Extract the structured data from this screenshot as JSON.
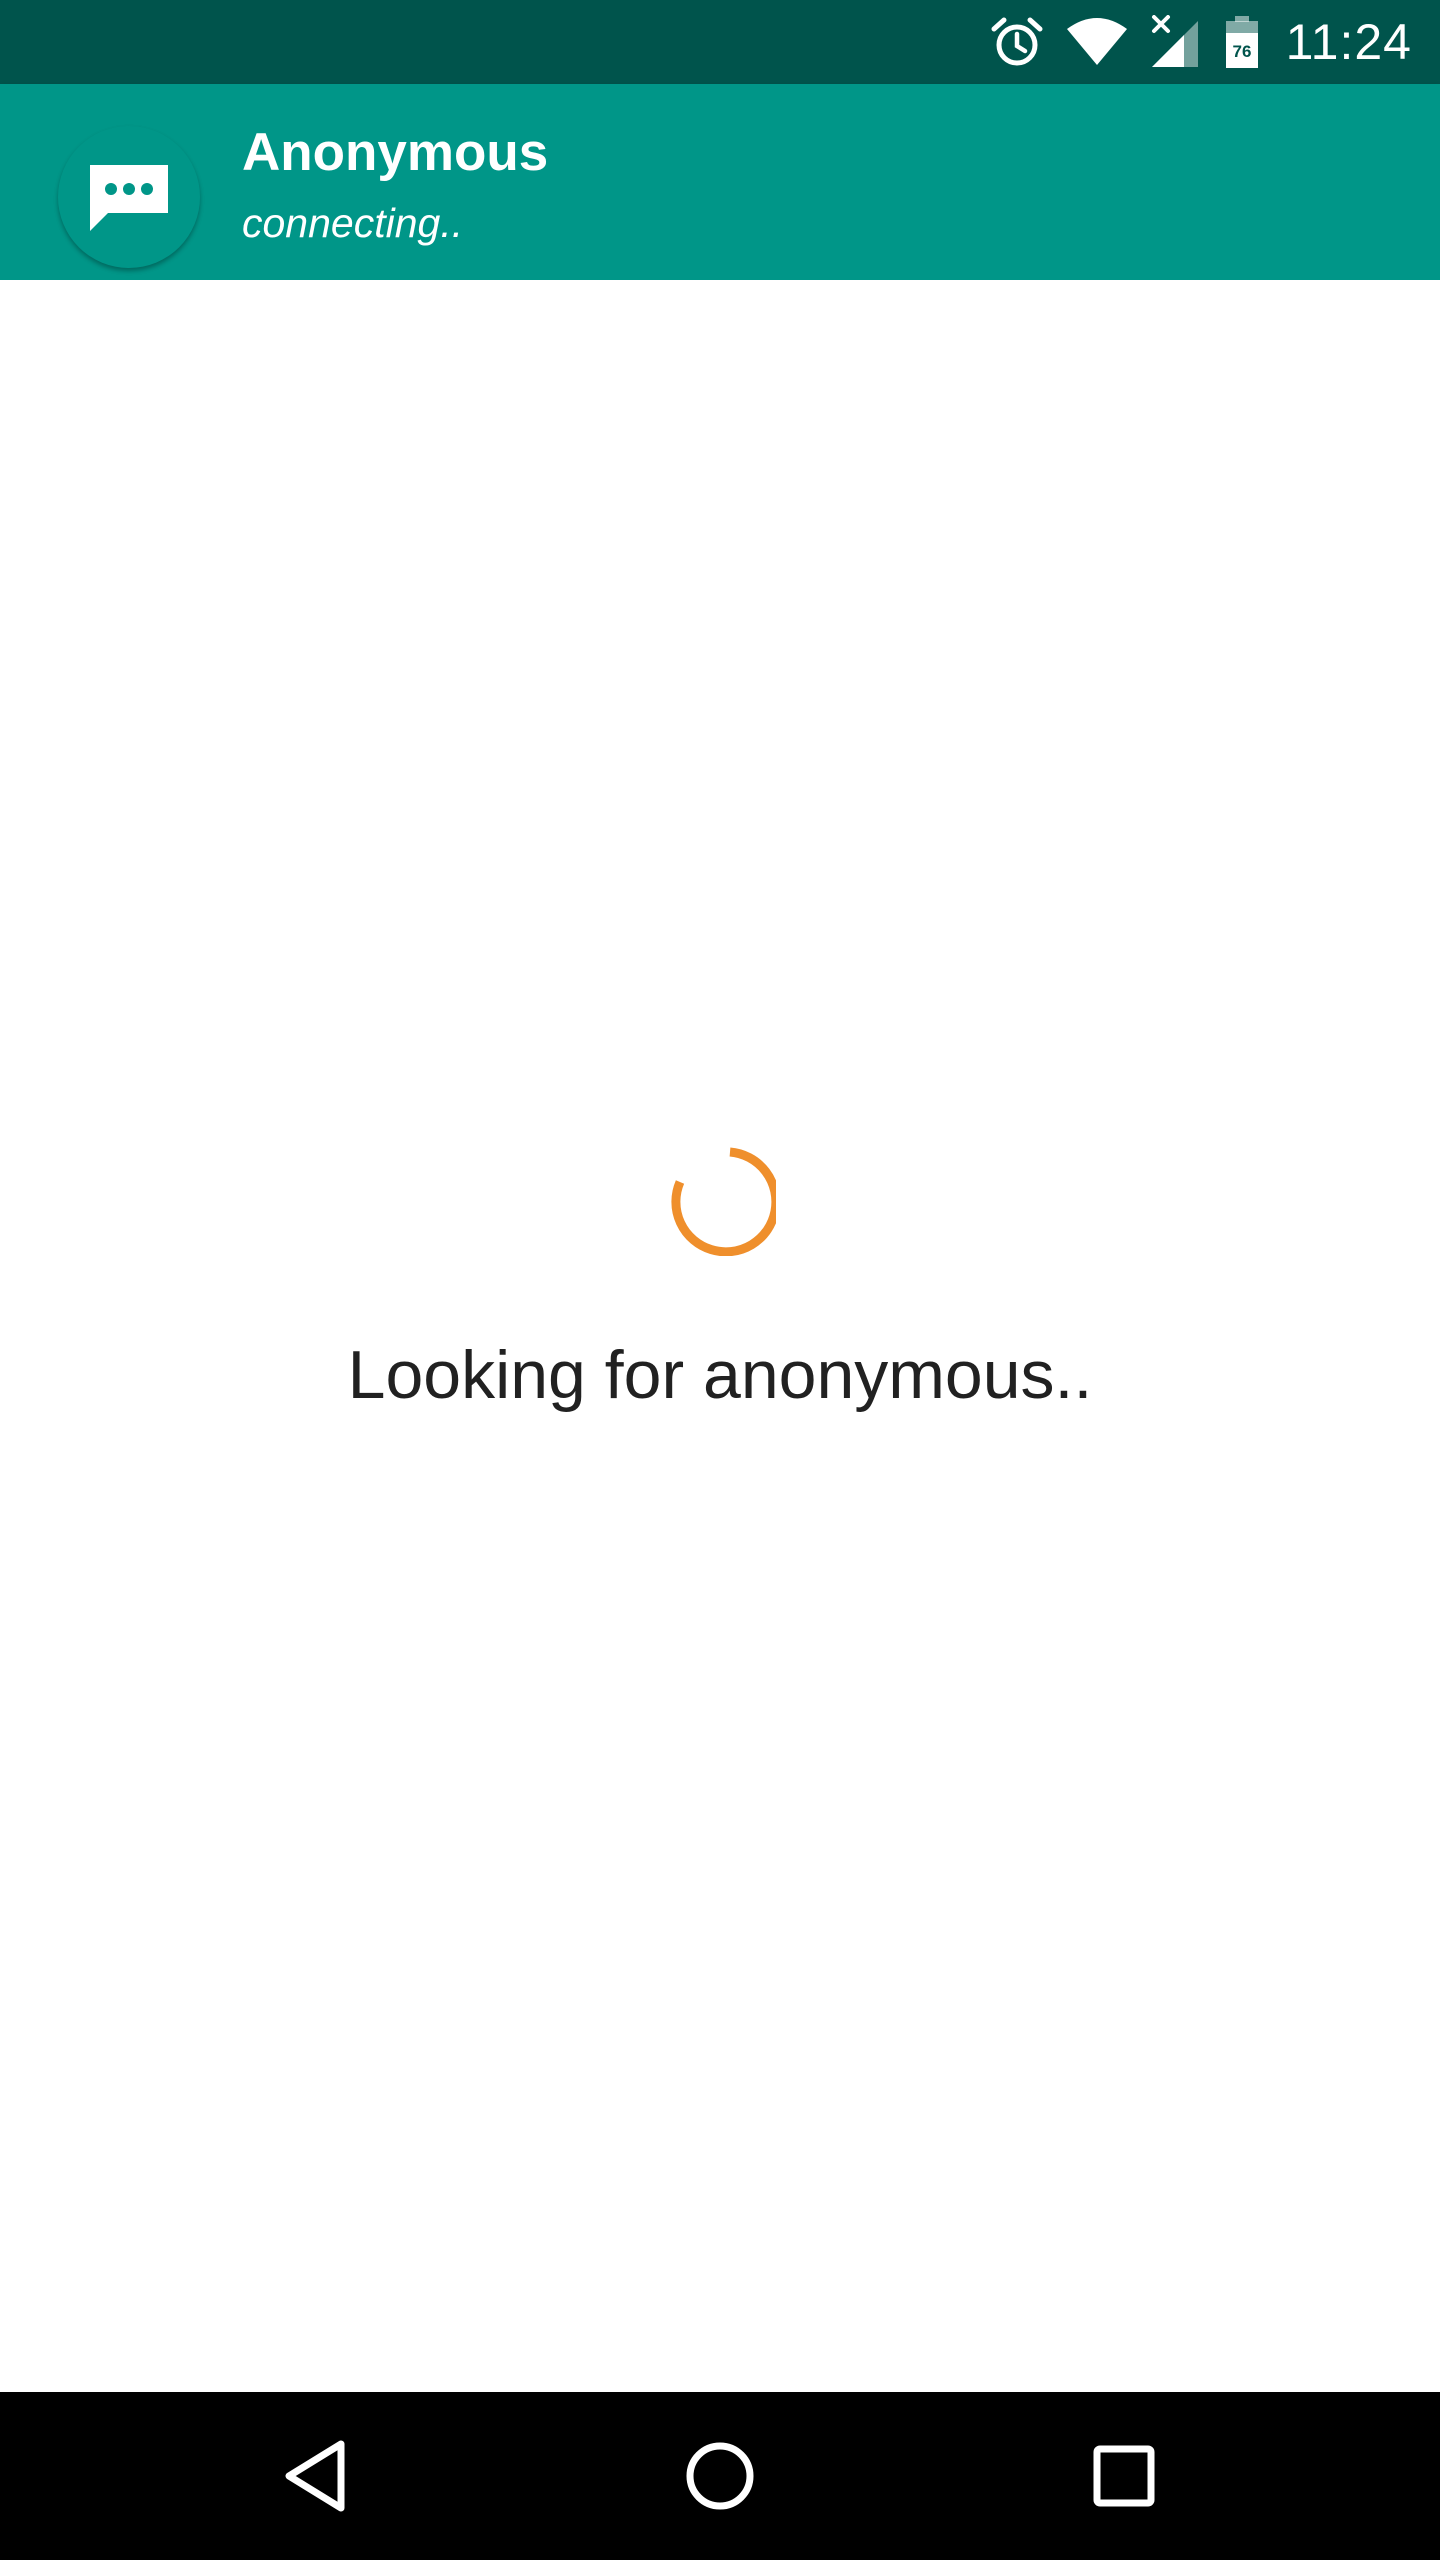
{
  "status_bar": {
    "time": "11:24",
    "battery_level": "76",
    "icons": [
      "alarm-icon",
      "wifi-icon",
      "cell-signal-icon",
      "battery-icon"
    ]
  },
  "app_bar": {
    "title": "Anonymous",
    "subtitle": "connecting..",
    "avatar_icon": "chat-bubble-icon"
  },
  "main": {
    "loading_text": "Looking for anonymous..",
    "spinner_color": "#ef8f2c"
  },
  "nav_bar": {
    "buttons": [
      "back-icon",
      "home-icon",
      "recents-icon"
    ]
  },
  "colors": {
    "status_bar": "#00544c",
    "app_bar": "#009688",
    "accent": "#ef8f2c"
  }
}
